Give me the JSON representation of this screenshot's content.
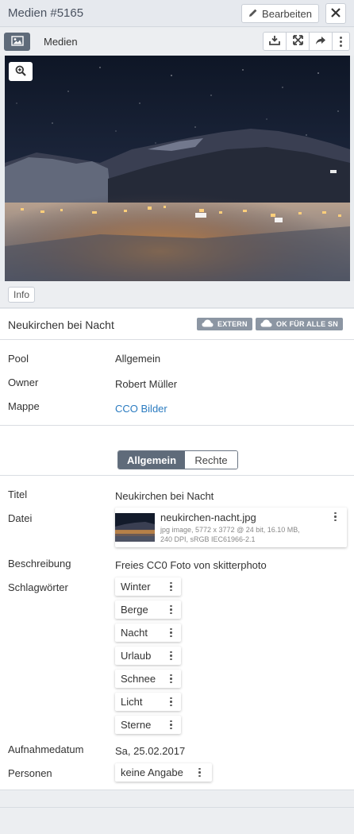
{
  "header": {
    "title": "Medien #5165",
    "edit_label": "Bearbeiten"
  },
  "media_toolbar": {
    "label": "Medien"
  },
  "info_label": "Info",
  "media": {
    "name": "Neukirchen bei Nacht",
    "badges": [
      "EXTERN",
      "OK FÜR ALLE SN"
    ]
  },
  "meta": {
    "pool_label": "Pool",
    "pool_value": "Allgemein",
    "owner_label": "Owner",
    "owner_value": "Robert Müller",
    "folder_label": "Mappe",
    "folder_value": "CCO Bilder"
  },
  "tabs": {
    "active": "Allgemein",
    "inactive": "Rechte"
  },
  "details": {
    "title_label": "Titel",
    "title_value": "Neukirchen bei Nacht",
    "file_label": "Datei",
    "file_name": "neukirchen-nacht.jpg",
    "file_meta": "jpg image,  5772 x 3772 @ 24 bit,  16.10 MB,  240 DPI,  sRGB IEC61966-2.1",
    "description_label": "Beschreibung",
    "description_value": "Freies CC0 Foto von skitterphoto",
    "keywords_label": "Schlagwörter",
    "keywords": [
      "Winter",
      "Berge",
      "Nacht",
      "Urlaub",
      "Schnee",
      "Licht",
      "Sterne"
    ],
    "date_label": "Aufnahmedatum",
    "date_value": "Sa, 25.02.2017",
    "persons_label": "Personen",
    "persons_value": "keine Angabe"
  },
  "icons": {
    "edit": "pencil-icon",
    "close": "close-icon",
    "media_toggle": "image-icon",
    "download": "download-icon",
    "fullscreen": "expand-icon",
    "share": "share-icon",
    "more": "more-vertical-icon",
    "zoom": "zoom-in-icon",
    "cloud": "cloud-icon"
  },
  "colors": {
    "accent": "#5f6b7a",
    "link": "#2a7bc0",
    "badge": "#8c96a3"
  }
}
